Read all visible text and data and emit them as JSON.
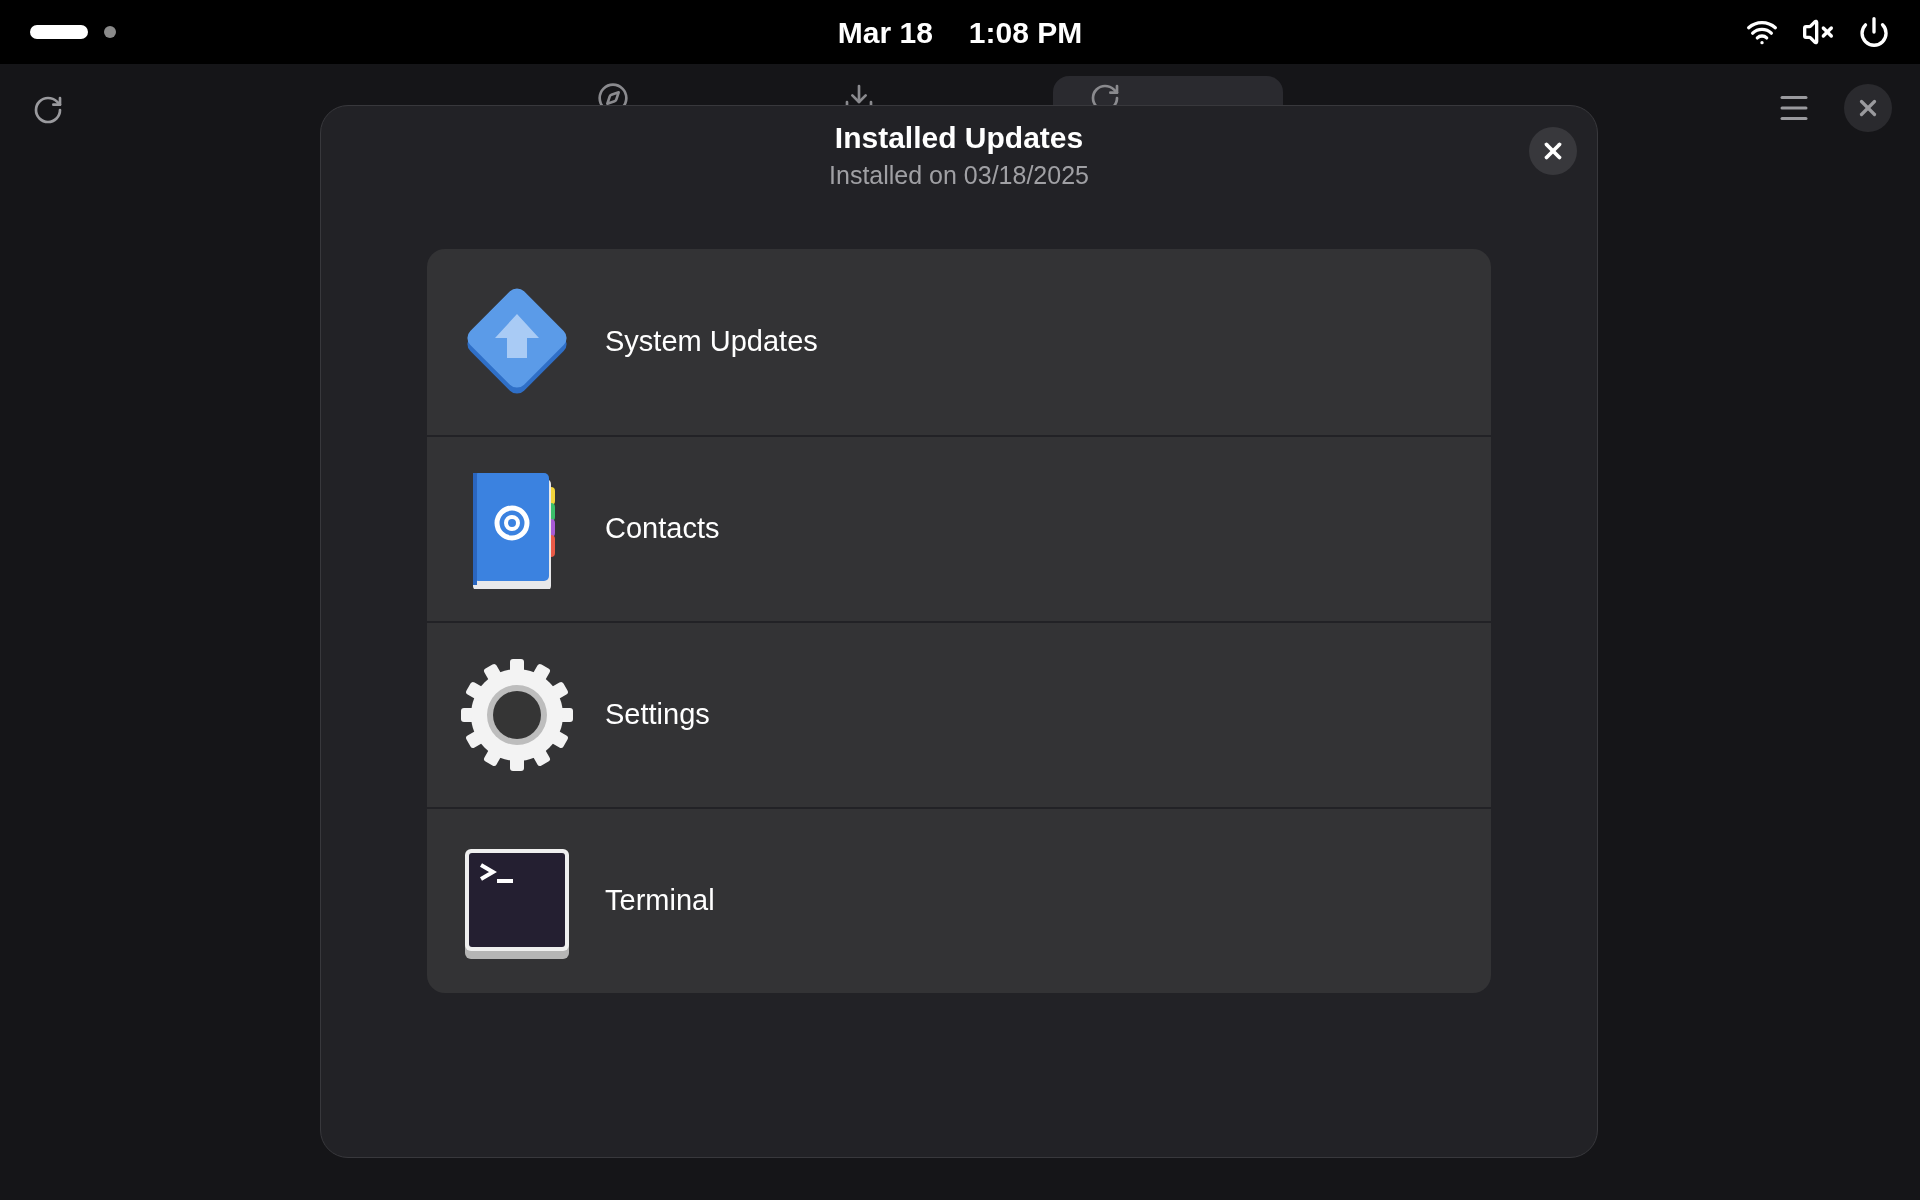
{
  "top_bar": {
    "date": "Mar 18",
    "time": "1:08 PM",
    "workspaces": [
      {
        "selected": true
      },
      {
        "selected": false
      }
    ],
    "muted": true
  },
  "header": {
    "tabs": [
      {
        "selected": false
      },
      {
        "selected": false
      },
      {
        "selected": true
      }
    ]
  },
  "dialog": {
    "title": "Installed Updates",
    "subtitle": "Installed on 03/18/2025",
    "items": [
      {
        "kind": "system",
        "name": "System Updates"
      },
      {
        "kind": "contacts",
        "name": "Contacts"
      },
      {
        "kind": "settings",
        "name": "Settings"
      },
      {
        "kind": "terminal",
        "name": "Terminal"
      }
    ]
  }
}
